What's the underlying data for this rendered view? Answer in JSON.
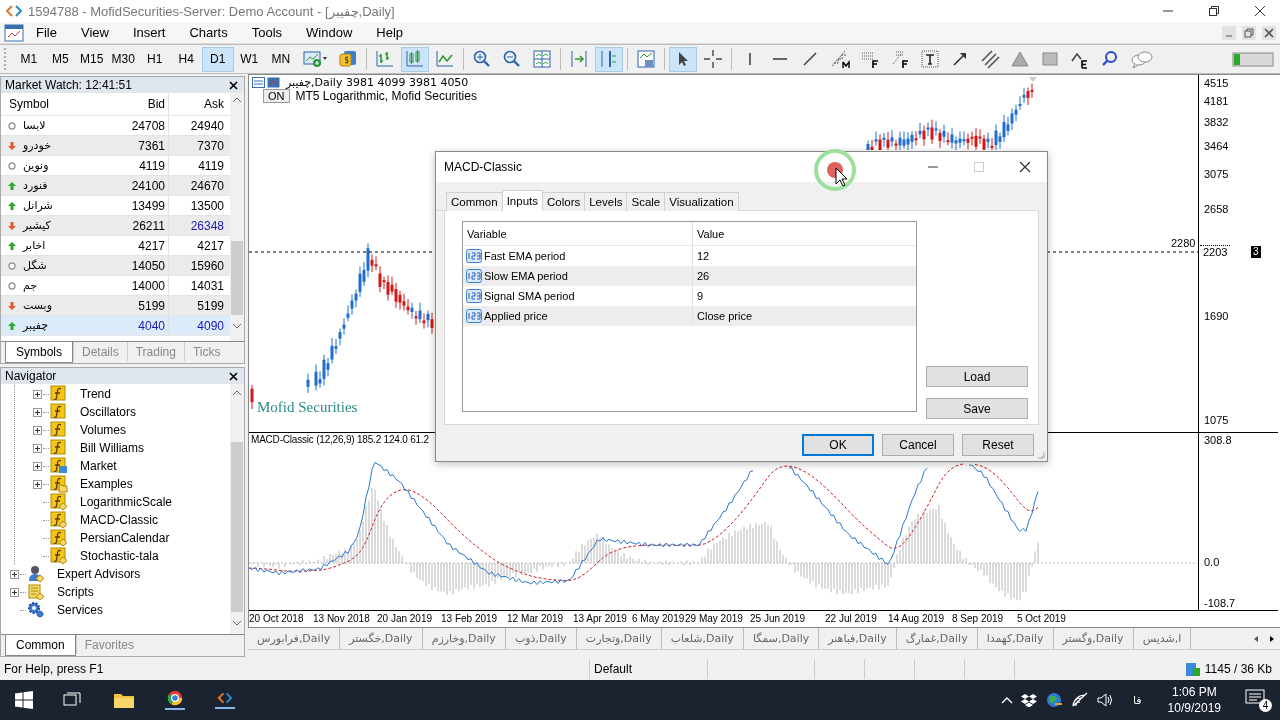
{
  "window": {
    "title": "1594788 - MofidSecurities-Server: Demo Account - [چفیبر,Daily]"
  },
  "menu": {
    "items": [
      "File",
      "View",
      "Insert",
      "Charts",
      "Tools",
      "Window",
      "Help"
    ]
  },
  "toolbar": {
    "timeframes": [
      {
        "label": "M1",
        "selected": false
      },
      {
        "label": "M5",
        "selected": false
      },
      {
        "label": "M15",
        "selected": false
      },
      {
        "label": "M30",
        "selected": false
      },
      {
        "label": "H1",
        "selected": false
      },
      {
        "label": "H4",
        "selected": false
      },
      {
        "label": "D1",
        "selected": true
      },
      {
        "label": "W1",
        "selected": false
      },
      {
        "label": "MN",
        "selected": false
      }
    ],
    "tools": [
      {
        "kind": "new-chart",
        "selected": false
      },
      {
        "kind": "market",
        "selected": false
      },
      {
        "kind": "sep"
      },
      {
        "kind": "bars",
        "selected": false
      },
      {
        "kind": "candles",
        "selected": true
      },
      {
        "kind": "line",
        "selected": false
      },
      {
        "kind": "sep"
      },
      {
        "kind": "zoom-in",
        "selected": false
      },
      {
        "kind": "zoom-out",
        "selected": false
      },
      {
        "kind": "tile",
        "selected": false
      },
      {
        "kind": "sep"
      },
      {
        "kind": "autoscroll",
        "selected": false
      },
      {
        "kind": "shift",
        "selected": true
      },
      {
        "kind": "sep"
      },
      {
        "kind": "template",
        "selected": false
      },
      {
        "kind": "sep"
      },
      {
        "kind": "cursor",
        "selected": true
      },
      {
        "kind": "crosshair",
        "selected": false
      },
      {
        "kind": "sep"
      },
      {
        "kind": "vline",
        "selected": false
      },
      {
        "kind": "hline",
        "selected": false
      },
      {
        "kind": "trend",
        "selected": false
      },
      {
        "kind": "stairs",
        "selected": false
      },
      {
        "kind": "fibo",
        "selected": false
      },
      {
        "kind": "fan",
        "selected": false
      },
      {
        "kind": "text",
        "selected": false
      },
      {
        "kind": "arrow",
        "selected": false
      },
      {
        "kind": "channel",
        "selected": false
      },
      {
        "kind": "triangle",
        "selected": false
      },
      {
        "kind": "rectangle",
        "selected": false
      },
      {
        "kind": "wave",
        "selected": false
      },
      {
        "kind": "search",
        "selected": false
      },
      {
        "kind": "chat",
        "selected": false
      },
      {
        "kind": "signal",
        "selected": false
      }
    ]
  },
  "market_watch": {
    "title": "Market Watch: 12:41:51",
    "columns": [
      "Symbol",
      "Bid",
      "Ask"
    ],
    "rows": [
      {
        "symbol": "لابسا",
        "bid": "24708",
        "ask": "24940",
        "kind": "none",
        "selected": false,
        "ask_changed": false
      },
      {
        "symbol": "خودرو",
        "bid": "7361",
        "ask": "7370",
        "kind": "down",
        "selected": false,
        "ask_changed": false
      },
      {
        "symbol": "ونوین",
        "bid": "4119",
        "ask": "4119",
        "kind": "none",
        "selected": false,
        "ask_changed": false
      },
      {
        "symbol": "فنورد",
        "bid": "24100",
        "ask": "24670",
        "kind": "up",
        "selected": false,
        "ask_changed": false
      },
      {
        "symbol": "شرانل",
        "bid": "13499",
        "ask": "13500",
        "kind": "up",
        "selected": false,
        "ask_changed": false
      },
      {
        "symbol": "کیشیر",
        "bid": "26211",
        "ask": "26348",
        "kind": "down",
        "selected": false,
        "ask_changed": true
      },
      {
        "symbol": "اخابر",
        "bid": "4217",
        "ask": "4217",
        "kind": "up",
        "selected": false,
        "ask_changed": false
      },
      {
        "symbol": "شگل",
        "bid": "14050",
        "ask": "15960",
        "kind": "none",
        "selected": false,
        "ask_changed": false
      },
      {
        "symbol": "جم",
        "bid": "14000",
        "ask": "14031",
        "kind": "none",
        "selected": false,
        "ask_changed": false
      },
      {
        "symbol": "وبست",
        "bid": "5199",
        "ask": "5199",
        "kind": "down",
        "selected": false,
        "ask_changed": false
      },
      {
        "symbol": "چفیبر",
        "bid": "4040",
        "ask": "4090",
        "kind": "up",
        "selected": true,
        "ask_changed": false
      }
    ],
    "tabs": [
      {
        "label": "Symbols",
        "selected": true
      },
      {
        "label": "Details",
        "selected": false
      },
      {
        "label": "Trading",
        "selected": false
      },
      {
        "label": "Ticks",
        "selected": false
      }
    ]
  },
  "navigator": {
    "title": "Navigator",
    "items": [
      {
        "children": [
          {
            "label": "Trend",
            "kind": "folder",
            "expanded": false
          },
          {
            "label": "Oscillators",
            "kind": "folder",
            "expanded": false
          },
          {
            "label": "Volumes",
            "kind": "folder",
            "expanded": false
          },
          {
            "label": "Bill Williams",
            "kind": "folder",
            "expanded": false
          },
          {
            "label": "Market",
            "kind": "market",
            "expanded": false
          },
          {
            "label": "Examples",
            "kind": "examples",
            "expanded": false
          },
          {
            "label": "LogarithmicScale",
            "kind": "indicator"
          },
          {
            "label": "MACD-Classic",
            "kind": "indicator"
          },
          {
            "label": "PersianCalendar",
            "kind": "indicator"
          },
          {
            "label": "Stochastic-tala",
            "kind": "indicator"
          }
        ]
      },
      {
        "label": "Expert Advisors",
        "kind": "experts",
        "expanded": false
      },
      {
        "label": "Scripts",
        "kind": "scripts",
        "expanded": false
      },
      {
        "label": "Services",
        "kind": "services"
      }
    ],
    "tabs": [
      {
        "label": "Common",
        "selected": true
      },
      {
        "label": "Favorites",
        "selected": false
      }
    ]
  },
  "chart": {
    "header": "چفیبر,Daily  3981 4099 3981 4050",
    "on_button": "ON",
    "subtitle": "MT5 Logarithmic, Mofid Securities",
    "watermark": "Mofid Securities",
    "price_labels": [
      "4515",
      "4181",
      "3832",
      "3464",
      "3075",
      "2658",
      "1690",
      "1075"
    ],
    "level_label": "2280",
    "current_price": "2203",
    "current_badge": "3",
    "macd_label": "MACD-Classic (12,26,9) 185.2 124.0 61.2",
    "macd_labels": [
      "308.8",
      "0.0",
      "-108.7"
    ],
    "dates": [
      "20 Oct 2018",
      "13 Nov 2018",
      "20 Jan 2019",
      "13 Feb 2019",
      "12 Mar 2019",
      "13 Apr 2019",
      "6 May 2019",
      "29 May 2019",
      "25 Jun 2019",
      "22 Jul 2019",
      "14 Aug 2019",
      "8 Sep 2019",
      "5 Oct 2019"
    ]
  },
  "chart_tabs": [
    "فرابورس,Daily",
    "خگستر,Daily",
    "وخارزم,Daily",
    "ذوب,Daily",
    "وتجارت,Daily",
    "شلعاب,Daily",
    "سمگا,Daily",
    "فباهنر,Daily",
    "غمارگ,Daily",
    "کهمدا,Daily",
    "وگستر,Daily",
    "ا,شدیس"
  ],
  "dialog": {
    "title": "MACD-Classic",
    "tabs": [
      {
        "label": "Common",
        "selected": false
      },
      {
        "label": "Inputs",
        "selected": true
      },
      {
        "label": "Colors",
        "selected": false
      },
      {
        "label": "Levels",
        "selected": false
      },
      {
        "label": "Scale",
        "selected": false
      },
      {
        "label": "Visualization",
        "selected": false
      }
    ],
    "columns": [
      "Variable",
      "Value"
    ],
    "rows": [
      {
        "variable": "Fast EMA period",
        "value": "12"
      },
      {
        "variable": "Slow EMA period",
        "value": "26"
      },
      {
        "variable": "Signal SMA period",
        "value": "9"
      },
      {
        "variable": "Applied price",
        "value": "Close price"
      }
    ],
    "side_buttons": [
      "Load",
      "Save"
    ],
    "buttons": [
      {
        "label": "OK",
        "default": true
      },
      {
        "label": "Cancel",
        "default": false
      },
      {
        "label": "Reset",
        "default": false
      }
    ]
  },
  "status_bar": {
    "help": "For Help, press F1",
    "profile": "Default",
    "traffic": "1145 / 36 Kb"
  },
  "taskbar": {
    "language": "فا",
    "time": "1:06 PM",
    "date": "10/9/2019",
    "notifications": "4"
  }
}
